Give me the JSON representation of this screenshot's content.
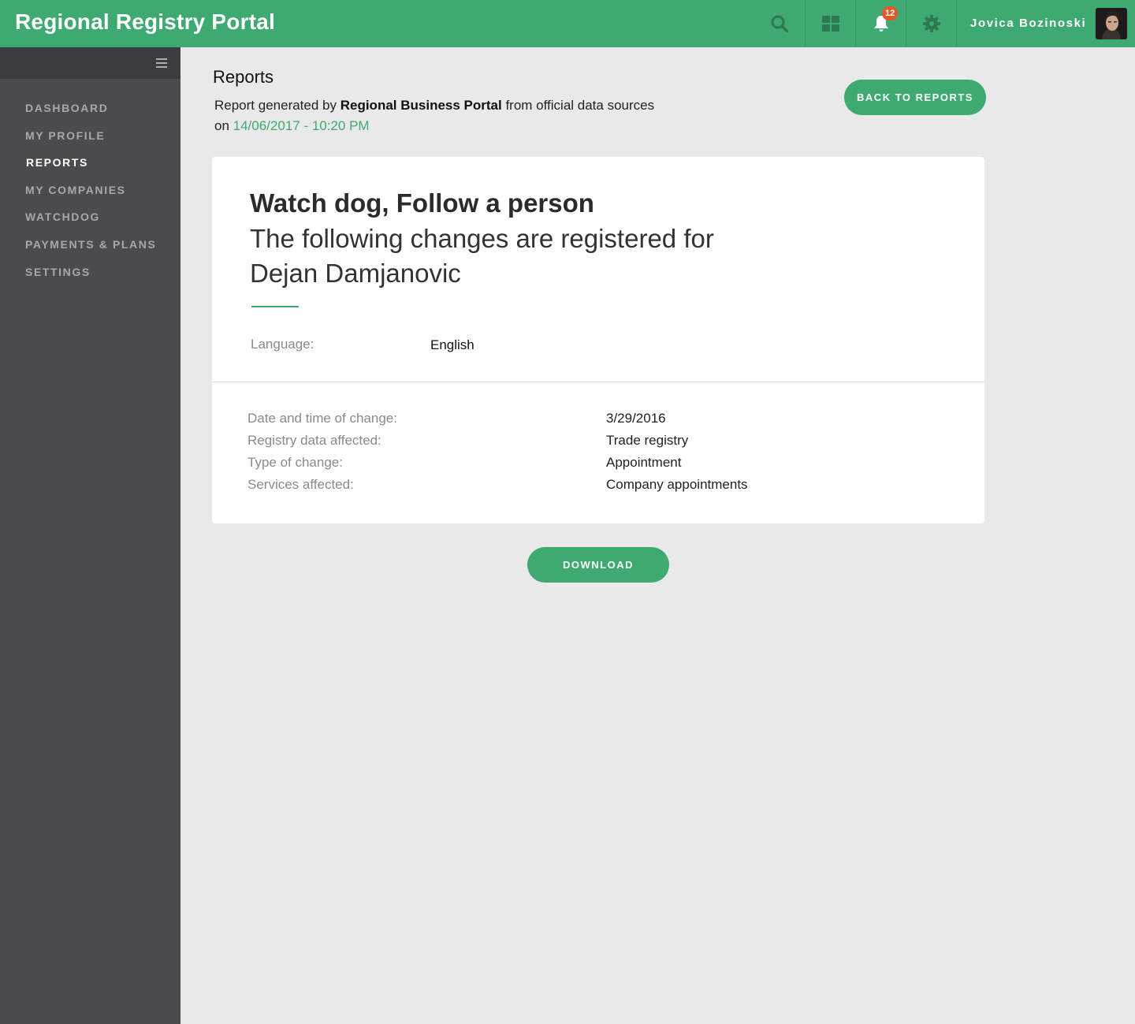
{
  "app": {
    "title": "Regional Registry Portal",
    "accent_color": "#3eaa72",
    "badge_color": "#e8572a"
  },
  "topbar": {
    "icons": [
      "search-icon",
      "grid-icon",
      "bell-icon",
      "gear-icon"
    ],
    "notifications_count": "12",
    "user_name": "Jovica Bozinoski"
  },
  "sidebar": {
    "items": [
      {
        "label": "DASHBOARD",
        "active": false
      },
      {
        "label": "MY PROFILE",
        "active": false
      },
      {
        "label": "REPORTS",
        "active": true
      },
      {
        "label": "MY COMPANIES",
        "active": false
      },
      {
        "label": "WATCHDOG",
        "active": false
      },
      {
        "label": "PAYMENTS & PLANS",
        "active": false
      },
      {
        "label": "SETTINGS",
        "active": false
      }
    ]
  },
  "header": {
    "title": "Reports",
    "sub_prefix": "Report generated by ",
    "sub_source": "Regional Business Portal",
    "sub_suffix": " from official data sources",
    "sub_on": "on ",
    "sub_date": "14/06/2017 - 10:20 PM",
    "back_button": "BACK TO REPORTS"
  },
  "report": {
    "title": "Watch dog, Follow a person",
    "subtitle": "The following changes are registered for Dejan Damjanovic",
    "language_label": "Language:",
    "language_value": "English",
    "details": [
      {
        "label": "Date and time of change:",
        "value": "3/29/2016"
      },
      {
        "label": "Registry data affected:",
        "value": "Trade registry"
      },
      {
        "label": "Type of change:",
        "value": "Appointment"
      },
      {
        "label": "Services affected:",
        "value": "Company appointments"
      }
    ]
  },
  "actions": {
    "download_label": "DOWNLOAD"
  }
}
